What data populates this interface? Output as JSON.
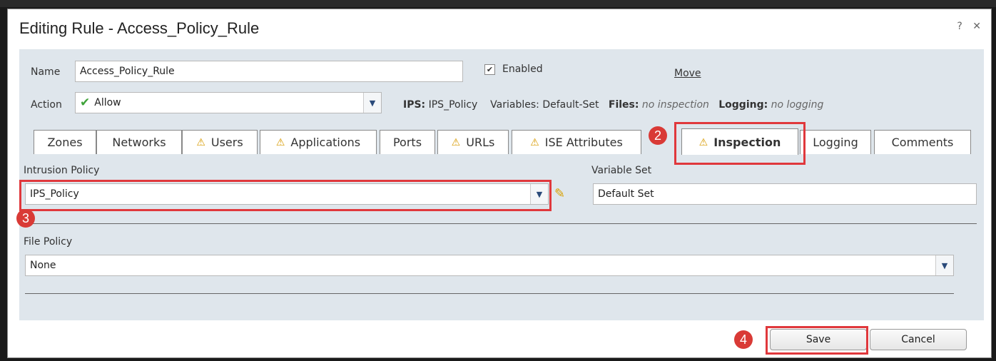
{
  "dialog": {
    "title": "Editing Rule - Access_Policy_Rule",
    "help": "?",
    "close": "✕"
  },
  "form": {
    "name_label": "Name",
    "name_value": "Access_Policy_Rule",
    "enabled_label": "Enabled",
    "enabled_checked": true,
    "move_label": "Move",
    "action_label": "Action",
    "action_value": "Allow"
  },
  "summary": {
    "ips_label": "IPS:",
    "ips_value": "IPS_Policy",
    "variables_label": "Variables:",
    "variables_value": "Default-Set",
    "files_label": "Files:",
    "files_value": "no inspection",
    "logging_label": "Logging:",
    "logging_value": "no logging"
  },
  "tabs": [
    {
      "label": "Zones",
      "warning": false
    },
    {
      "label": "Networks",
      "warning": false
    },
    {
      "label": "Users",
      "warning": true
    },
    {
      "label": "Applications",
      "warning": true
    },
    {
      "label": "Ports",
      "warning": false
    },
    {
      "label": "URLs",
      "warning": true
    },
    {
      "label": "ISE Attributes",
      "warning": true
    },
    {
      "label": "Inspection",
      "warning": true,
      "active": true
    },
    {
      "label": "Logging",
      "warning": false
    },
    {
      "label": "Comments",
      "warning": false
    }
  ],
  "inspection": {
    "intrusion_policy_label": "Intrusion Policy",
    "intrusion_policy_value": "IPS_Policy",
    "variable_set_label": "Variable Set",
    "variable_set_value": "Default Set",
    "file_policy_label": "File Policy",
    "file_policy_value": "None"
  },
  "buttons": {
    "save": "Save",
    "cancel": "Cancel"
  },
  "annotations": {
    "step2": "2",
    "step3": "3",
    "step4": "4"
  },
  "colors": {
    "highlight": "#e0383c",
    "panel": "#dfe6ec",
    "warning": "#d89a00",
    "check_green": "#3fa33a"
  }
}
